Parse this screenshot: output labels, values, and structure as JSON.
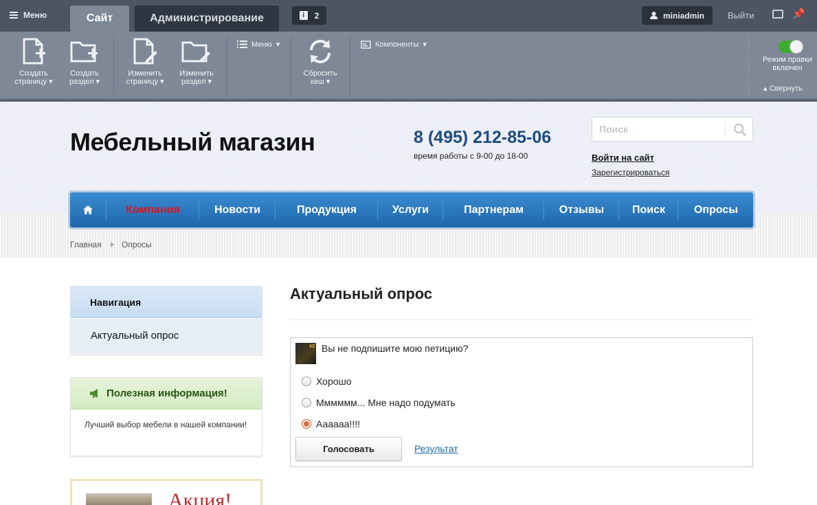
{
  "admin": {
    "menu_label": "Меню",
    "tabs": [
      {
        "label": "Сайт"
      },
      {
        "label": "Администрирование"
      }
    ],
    "notifications_count": "2",
    "user": "miniadmin",
    "logout": "Выйти",
    "toolbar": {
      "create_page": "Создать страницу",
      "create_section": "Создать раздел",
      "edit_page": "Изменить страницу",
      "edit_section": "Изменить раздел",
      "menu": "Меню",
      "reset_cache": "Сбросить кеш",
      "components": "Компоненты",
      "edit_mode": "Режим правки включен",
      "collapse": "Свернуть"
    },
    "edit_mode_on": true
  },
  "header": {
    "site_title": "Мебельный магазин",
    "phone": "8 (495) 212-85-06",
    "hours": "время работы с 9-00 до 18-00",
    "search_placeholder": "Поиск",
    "login": "Войти на сайт",
    "register": "Зарегистрироваться"
  },
  "nav": {
    "items": [
      {
        "label": "Компания",
        "active": true
      },
      {
        "label": "Новости"
      },
      {
        "label": "Продукция"
      },
      {
        "label": "Услуги"
      },
      {
        "label": "Партнерам"
      },
      {
        "label": "Отзывы"
      },
      {
        "label": "Поиск"
      },
      {
        "label": "Опросы"
      }
    ]
  },
  "breadcrumb": [
    {
      "label": "Главная"
    },
    {
      "label": "Опросы"
    }
  ],
  "sidebar": {
    "nav_title": "Навигация",
    "nav_items": [
      {
        "label": "Актуальный опрос"
      }
    ],
    "info_title": "Полезная информация!",
    "info_text": "Лучший выбор мебели в нашей компании!",
    "promo_text": "Акция!"
  },
  "main": {
    "title": "Актуальный опрос",
    "poll": {
      "image_text": "#2",
      "question": "Вы не подпишите мою петицию?",
      "options": [
        {
          "label": "Хорошо",
          "selected": false
        },
        {
          "label": "Мммммм... Мне надо подумать",
          "selected": false
        },
        {
          "label": "Аааааа!!!!",
          "selected": true
        }
      ],
      "vote_button": "Голосовать",
      "result_link": "Результат"
    }
  },
  "colors": {
    "admin_bar": "#4d5563",
    "toolbar": "#7e8896",
    "nav_blue": "#2a78c0",
    "active_nav": "#d9181f",
    "phone": "#1d4c81",
    "toggle_on": "#3faa2f"
  }
}
